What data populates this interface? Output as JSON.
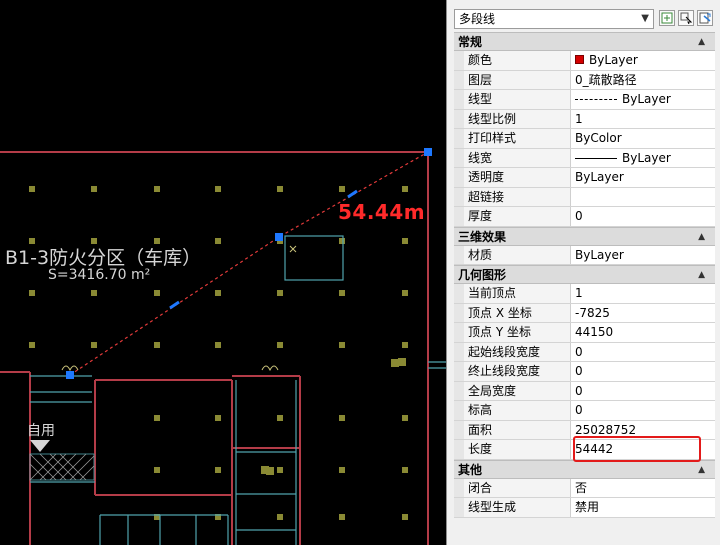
{
  "drawing": {
    "distance_label": "54.44m",
    "zone_title": "B1-3防火分区（车库）",
    "zone_area": "S=3416.70 m²",
    "zone_code": "自用"
  },
  "palette": {
    "object_type": "多段线",
    "toolbar_icons": [
      "toggle-pickadd-icon",
      "select-objects-icon",
      "quick-select-icon"
    ],
    "categories": [
      {
        "name": "常规",
        "rows": [
          {
            "label": "颜色",
            "value": "ByLayer",
            "kind": "color",
            "color": "#d40000"
          },
          {
            "label": "图层",
            "value": "0_疏散路径"
          },
          {
            "label": "线型",
            "value": "ByLayer",
            "kind": "dash"
          },
          {
            "label": "线型比例",
            "value": "1"
          },
          {
            "label": "打印样式",
            "value": "ByColor"
          },
          {
            "label": "线宽",
            "value": "ByLayer",
            "kind": "line"
          },
          {
            "label": "透明度",
            "value": "ByLayer"
          },
          {
            "label": "超链接",
            "value": ""
          },
          {
            "label": "厚度",
            "value": "0"
          }
        ]
      },
      {
        "name": "三维效果",
        "rows": [
          {
            "label": "材质",
            "value": "ByLayer"
          }
        ]
      },
      {
        "name": "几何图形",
        "rows": [
          {
            "label": "当前顶点",
            "value": "1"
          },
          {
            "label": "顶点 X 坐标",
            "value": "-7825"
          },
          {
            "label": "顶点 Y 坐标",
            "value": "44150"
          },
          {
            "label": "起始线段宽度",
            "value": "0"
          },
          {
            "label": "终止线段宽度",
            "value": "0"
          },
          {
            "label": "全局宽度",
            "value": "0"
          },
          {
            "label": "标高",
            "value": "0"
          },
          {
            "label": "面积",
            "value": "25028752"
          },
          {
            "label": "长度",
            "value": "54442",
            "highlight": true
          }
        ]
      },
      {
        "name": "其他",
        "rows": [
          {
            "label": "闭合",
            "value": "否"
          },
          {
            "label": "线型生成",
            "value": "禁用"
          }
        ]
      }
    ]
  },
  "colors": {
    "highlight": "#e31a1a",
    "distance_text": "#ff2a2a",
    "wall": "#b43c48",
    "partition": "#4fa3ad",
    "column": "#8a8a34",
    "grip": "#1e78ff"
  }
}
